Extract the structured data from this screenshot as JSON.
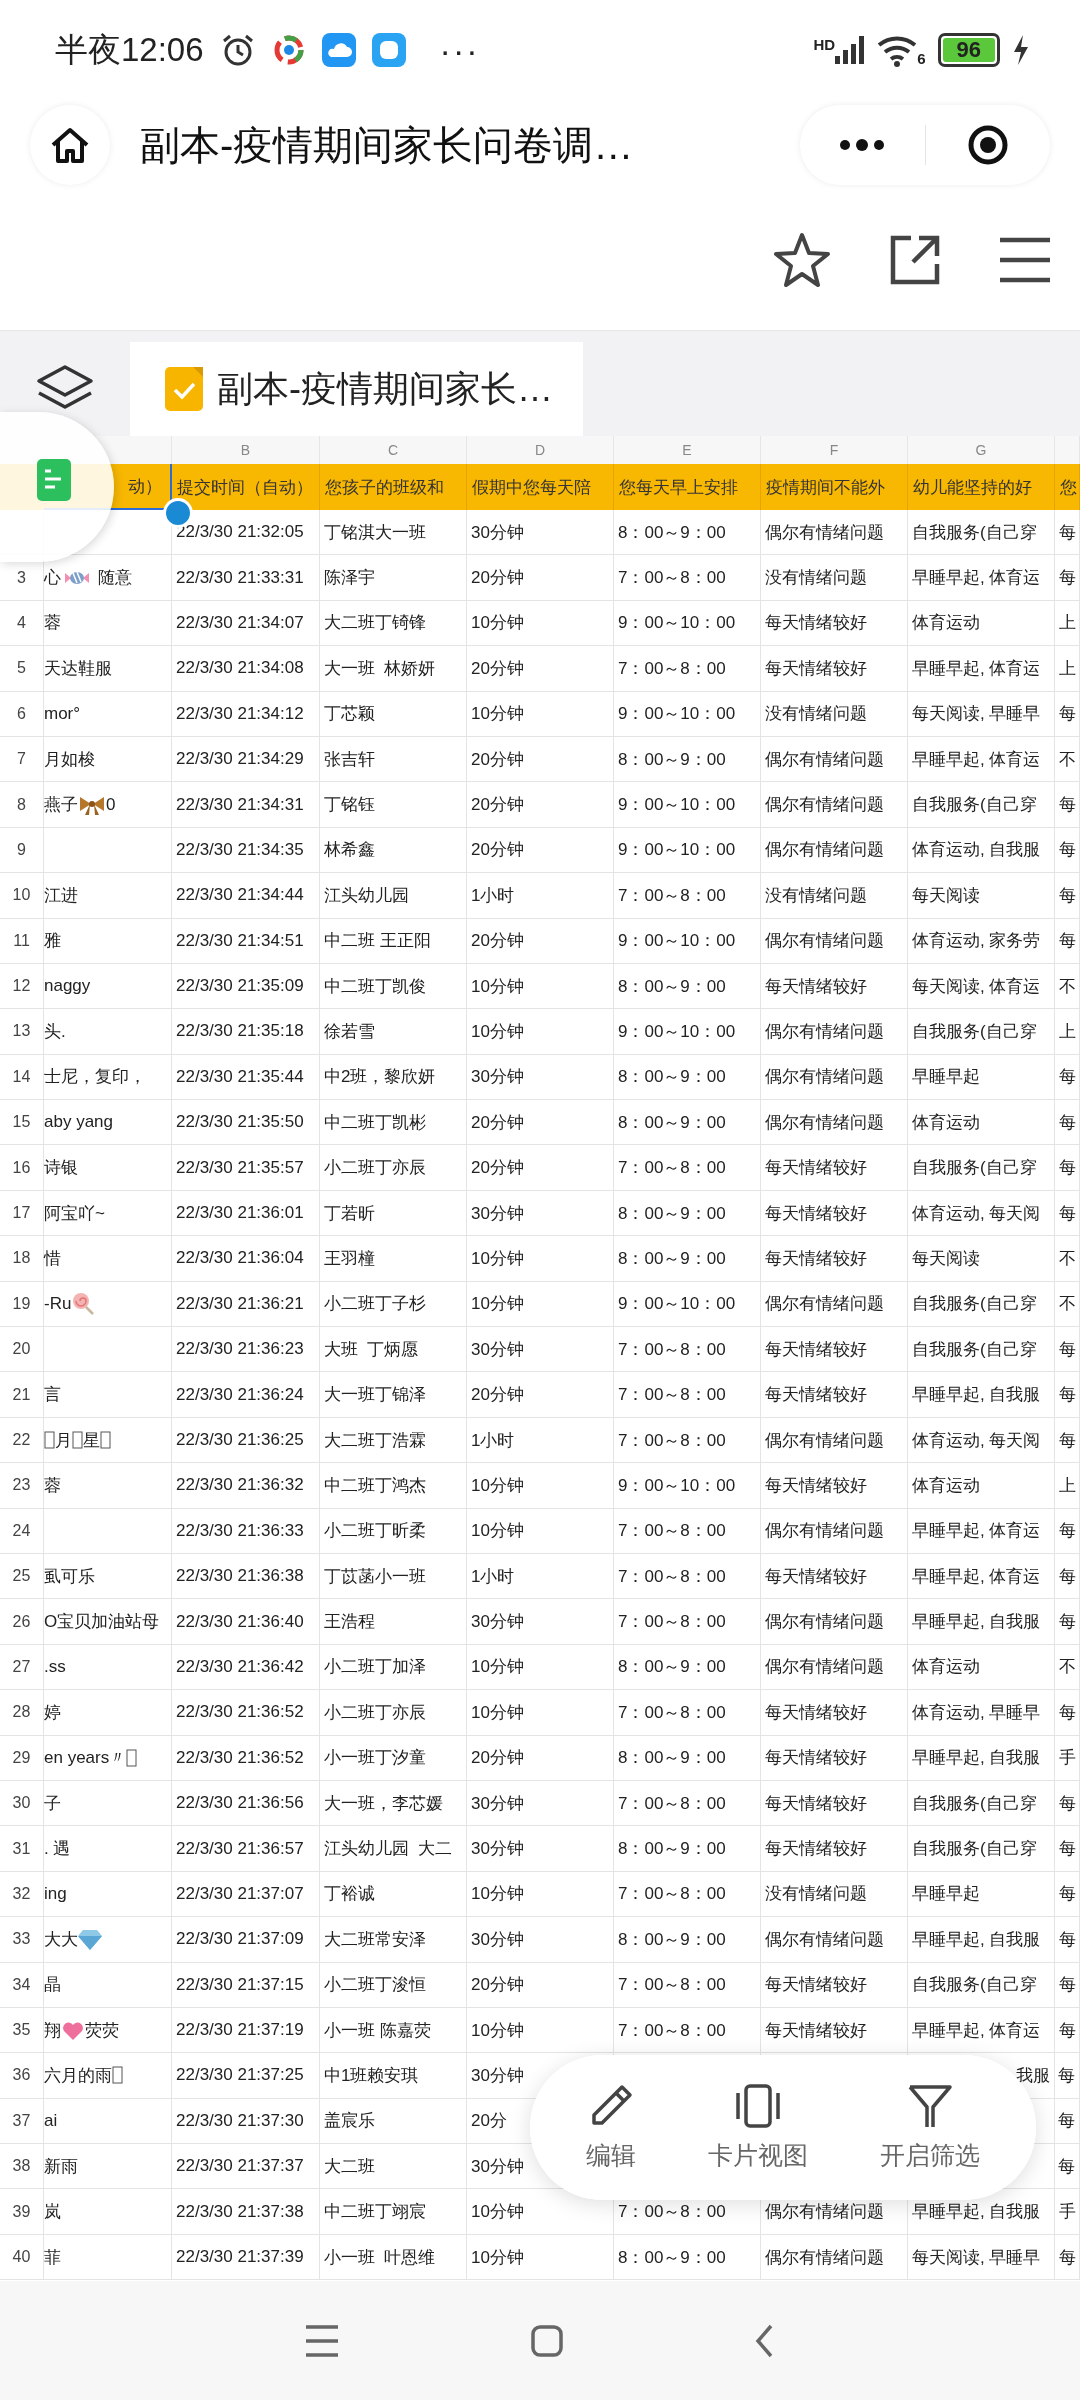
{
  "status_bar": {
    "time": "半夜12:06",
    "more": "···",
    "network_label": "HD",
    "wifi_label": "6",
    "battery": "96"
  },
  "title_bar": {
    "title": "副本-疫情期间家长问卷调…"
  },
  "sheet_tab": {
    "title": "副本-疫情期间家长…"
  },
  "table": {
    "column_letters": [
      "B",
      "C",
      "D",
      "E",
      "F",
      "G"
    ],
    "header": [
      {
        "text": "动）",
        "selected": true
      },
      {
        "text": "提交时间（自动）",
        "selected": false
      },
      {
        "text": "您孩子的班级和",
        "selected": false
      },
      {
        "text": "假期中您每天陪",
        "selected": false
      },
      {
        "text": "您每天早上安排",
        "selected": false
      },
      {
        "text": "疫情期间不能外",
        "selected": false
      },
      {
        "text": "幼儿能坚持的好",
        "selected": false
      },
      {
        "text": "您",
        "selected": false
      }
    ],
    "rows": [
      {
        "b": "22/3/30 21:32:05",
        "c": "丁铭淇大一班",
        "d": "30分钟",
        "e": "8：00～9：00",
        "f": "偶尔有情绪问题",
        "g": "自我服务(自己穿",
        "h": "每"
      },
      {
        "n": "3",
        "a": [
          "心",
          {
            "kind": "candy"
          },
          " 随意"
        ],
        "b": "22/3/30 21:33:31",
        "c": "陈泽宇",
        "d": "20分钟",
        "e": "7：00～8：00",
        "f": "没有情绪问题",
        "g": "早睡早起, 体育运",
        "h": "每"
      },
      {
        "n": "4",
        "a": [
          "蓉"
        ],
        "b": "22/3/30 21:34:07",
        "c": "大二班丁锜锋",
        "d": "10分钟",
        "e": "9：00～10：00",
        "f": "每天情绪较好",
        "g": "体育运动",
        "h": "上"
      },
      {
        "n": "5",
        "a": [
          "天达鞋服"
        ],
        "b": "22/3/30 21:34:08",
        "c": "大一班  林娇妍",
        "d": "20分钟",
        "e": "7：00～8：00",
        "f": "每天情绪较好",
        "g": "早睡早起, 体育运",
        "h": "上"
      },
      {
        "n": "6",
        "a": [
          "mor°"
        ],
        "b": "22/3/30 21:34:12",
        "c": "丁芯颖",
        "d": "10分钟",
        "e": "9：00～10：00",
        "f": "没有情绪问题",
        "g": "每天阅读, 早睡早",
        "h": "每"
      },
      {
        "n": "7",
        "a": [
          "月如梭"
        ],
        "b": "22/3/30 21:34:29",
        "c": "张吉轩",
        "d": "20分钟",
        "e": "8：00～9：00",
        "f": "偶尔有情绪问题",
        "g": "早睡早起, 体育运",
        "h": "不"
      },
      {
        "n": "8",
        "a": [
          "燕子",
          {
            "kind": "bow"
          },
          "0"
        ],
        "b": "22/3/30 21:34:31",
        "c": "丁铭钰",
        "d": "20分钟",
        "e": "9：00～10：00",
        "f": "偶尔有情绪问题",
        "g": "自我服务(自己穿",
        "h": "每"
      },
      {
        "n": "9",
        "b": "22/3/30 21:34:35",
        "c": "林希鑫",
        "d": "20分钟",
        "e": "9：00～10：00",
        "f": "偶尔有情绪问题",
        "g": "体育运动, 自我服",
        "h": "每"
      },
      {
        "n": "10",
        "a": [
          "江进"
        ],
        "b": "22/3/30 21:34:44",
        "c": "江头幼儿园",
        "d": "1小时",
        "e": "7：00～8：00",
        "f": "没有情绪问题",
        "g": "每天阅读",
        "h": "每"
      },
      {
        "n": "11",
        "a": [
          "雅"
        ],
        "b": "22/3/30 21:34:51",
        "c": "中二班 王正阳",
        "d": "20分钟",
        "e": "9：00～10：00",
        "f": "偶尔有情绪问题",
        "g": "体育运动, 家务劳",
        "h": "每"
      },
      {
        "n": "12",
        "a": [
          "naggy"
        ],
        "b": "22/3/30 21:35:09",
        "c": "中二班丁凯俊",
        "d": "10分钟",
        "e": "8：00～9：00",
        "f": "每天情绪较好",
        "g": "每天阅读, 体育运",
        "h": "不"
      },
      {
        "n": "13",
        "a": [
          "头."
        ],
        "b": "22/3/30 21:35:18",
        "c": "徐若雪",
        "d": "10分钟",
        "e": "9：00～10：00",
        "f": "偶尔有情绪问题",
        "g": "自我服务(自己穿",
        "h": "上"
      },
      {
        "n": "14",
        "a": [
          "士尼，复印，"
        ],
        "b": "22/3/30 21:35:44",
        "c": "中2班，黎欣妍",
        "d": "30分钟",
        "e": "8：00～9：00",
        "f": "偶尔有情绪问题",
        "g": "早睡早起",
        "h": "每"
      },
      {
        "n": "15",
        "a": [
          "aby yang"
        ],
        "b": "22/3/30 21:35:50",
        "c": "中二班丁凯彬",
        "d": "20分钟",
        "e": "8：00～9：00",
        "f": "偶尔有情绪问题",
        "g": "体育运动",
        "h": "每"
      },
      {
        "n": "16",
        "a": [
          "诗银"
        ],
        "b": "22/3/30 21:35:57",
        "c": "小二班丁亦辰",
        "d": "20分钟",
        "e": "7：00～8：00",
        "f": "每天情绪较好",
        "g": "自我服务(自己穿",
        "h": "每"
      },
      {
        "n": "17",
        "a": [
          "阿宝吖~"
        ],
        "b": "22/3/30 21:36:01",
        "c": "丁若昕",
        "d": "30分钟",
        "e": "8：00～9：00",
        "f": "每天情绪较好",
        "g": "体育运动, 每天阅",
        "h": "每"
      },
      {
        "n": "18",
        "a": [
          "惜"
        ],
        "b": "22/3/30 21:36:04",
        "c": "王羽橦",
        "d": "10分钟",
        "e": "8：00～9：00",
        "f": "每天情绪较好",
        "g": "每天阅读",
        "h": "不"
      },
      {
        "n": "19",
        "a": [
          "-Ru",
          {
            "kind": "lollipop"
          }
        ],
        "b": "22/3/30 21:36:21",
        "c": "小二班丁子杉",
        "d": "10分钟",
        "e": "9：00～10：00",
        "f": "偶尔有情绪问题",
        "g": "自我服务(自己穿",
        "h": "不"
      },
      {
        "n": "20",
        "b": "22/3/30 21:36:23",
        "c": "大班  丁炳愿",
        "d": "30分钟",
        "e": "7：00～8：00",
        "f": "每天情绪较好",
        "g": "自我服务(自己穿",
        "h": "每"
      },
      {
        "n": "21",
        "a": [
          "言"
        ],
        "b": "22/3/30 21:36:24",
        "c": "大一班丁锦泽",
        "d": "20分钟",
        "e": "7：00～8：00",
        "f": "每天情绪较好",
        "g": "早睡早起, 自我服",
        "h": "每"
      },
      {
        "n": "22",
        "a": [
          {
            "kind": "tofu"
          },
          "月",
          {
            "kind": "tofu"
          },
          "星",
          {
            "kind": "tofu"
          }
        ],
        "b": "22/3/30 21:36:25",
        "c": "大二班丁浩霖",
        "d": "1小时",
        "e": "7：00～8：00",
        "f": "偶尔有情绪问题",
        "g": "体育运动, 每天阅",
        "h": "每"
      },
      {
        "n": "23",
        "a": [
          "蓉"
        ],
        "b": "22/3/30 21:36:32",
        "c": "中二班丁鸿杰",
        "d": "10分钟",
        "e": "9：00～10：00",
        "f": "每天情绪较好",
        "g": "体育运动",
        "h": "上"
      },
      {
        "n": "24",
        "b": "22/3/30 21:36:33",
        "c": "小二班丁昕柔",
        "d": "10分钟",
        "e": "7：00～8：00",
        "f": "偶尔有情绪问题",
        "g": "早睡早起, 体育运",
        "h": "每"
      },
      {
        "n": "25",
        "a": [
          "虱可乐"
        ],
        "b": "22/3/30 21:36:38",
        "c": "丁苡菡小一班",
        "d": "1小时",
        "e": "7：00～8：00",
        "f": "每天情绪较好",
        "g": "早睡早起, 体育运",
        "h": "每"
      },
      {
        "n": "26",
        "a": [
          "O宝贝加油站母"
        ],
        "b": "22/3/30 21:36:40",
        "c": "王浩程",
        "d": "30分钟",
        "e": "7：00～8：00",
        "f": "偶尔有情绪问题",
        "g": "早睡早起, 自我服",
        "h": "每"
      },
      {
        "n": "27",
        "a": [
          ".ss"
        ],
        "b": "22/3/30 21:36:42",
        "c": "小二班丁加泽",
        "d": "10分钟",
        "e": "8：00～9：00",
        "f": "偶尔有情绪问题",
        "g": "体育运动",
        "h": "不"
      },
      {
        "n": "28",
        "a": [
          "婷"
        ],
        "b": "22/3/30 21:36:52",
        "c": "小二班丁亦辰",
        "d": "10分钟",
        "e": "7：00～8：00",
        "f": "每天情绪较好",
        "g": "体育运动, 早睡早",
        "h": "每"
      },
      {
        "n": "29",
        "a": [
          "en years〃",
          {
            "kind": "tofu"
          }
        ],
        "b": "22/3/30 21:36:52",
        "c": "小一班丁汐童",
        "d": "20分钟",
        "e": "8：00～9：00",
        "f": "每天情绪较好",
        "g": "早睡早起, 自我服",
        "h": "手"
      },
      {
        "n": "30",
        "a": [
          "子"
        ],
        "b": "22/3/30 21:36:56",
        "c": "大一班，李芯媛",
        "d": "30分钟",
        "e": "7：00～8：00",
        "f": "每天情绪较好",
        "g": "自我服务(自己穿",
        "h": "每"
      },
      {
        "n": "31",
        "a": [
          ". 遇"
        ],
        "b": "22/3/30 21:36:57",
        "c": "江头幼儿园  大二",
        "d": "30分钟",
        "e": "8：00～9：00",
        "f": "每天情绪较好",
        "g": "自我服务(自己穿",
        "h": "每"
      },
      {
        "n": "32",
        "a": [
          "ing"
        ],
        "b": "22/3/30 21:37:07",
        "c": "丁裕诚",
        "d": "10分钟",
        "e": "7：00～8：00",
        "f": "没有情绪问题",
        "g": "早睡早起",
        "h": "每"
      },
      {
        "n": "33",
        "a": [
          "大大",
          {
            "kind": "gem"
          }
        ],
        "b": "22/3/30 21:37:09",
        "c": "大二班常安泽",
        "d": "30分钟",
        "e": "8：00～9：00",
        "f": "偶尔有情绪问题",
        "g": "早睡早起, 自我服",
        "h": "每"
      },
      {
        "n": "34",
        "a": [
          "晶"
        ],
        "b": "22/3/30 21:37:15",
        "c": "小二班丁浚恒",
        "d": "20分钟",
        "e": "7：00～8：00",
        "f": "每天情绪较好",
        "g": "自我服务(自己穿",
        "h": "每"
      },
      {
        "n": "35",
        "a": [
          "翔",
          {
            "kind": "heart"
          },
          "荧荧"
        ],
        "b": "22/3/30 21:37:19",
        "c": "小一班 陈嘉荧",
        "d": "10分钟",
        "e": "7：00～8：00",
        "f": "每天情绪较好",
        "g": "早睡早起, 体育运",
        "h": "每"
      },
      {
        "n": "36",
        "a": [
          "六月的雨",
          {
            "kind": "tofu"
          }
        ],
        "b": "22/3/30 21:37:25",
        "c": "中1班赖安琪",
        "d": "30分钟",
        "g": "我服",
        "h": "每"
      },
      {
        "n": "37",
        "a": [
          "ai"
        ],
        "b": "22/3/30 21:37:30",
        "c": "盖宸乐",
        "d": "20分",
        "h": "每"
      },
      {
        "n": "38",
        "a": [
          "新雨"
        ],
        "b": "22/3/30 21:37:37",
        "c": "大二班",
        "d": "30分钟",
        "h": "每"
      },
      {
        "n": "39",
        "a": [
          "岚"
        ],
        "b": "22/3/30 21:37:38",
        "c": "中二班丁翊宸",
        "d": "10分钟",
        "e": "7：00～8：00",
        "f": "偶尔有情绪问题",
        "g": "早睡早起, 自我服",
        "h": "手"
      },
      {
        "n": "40",
        "a": [
          "菲"
        ],
        "b": "22/3/30 21:37:39",
        "c": "小一班  叶恩维",
        "d": "10分钟",
        "e": "8：00～9：00",
        "f": "偶尔有情绪问题",
        "g": "每天阅读, 早睡早",
        "h": "每"
      }
    ]
  },
  "actions": [
    {
      "label": "编辑",
      "kind": "edit"
    },
    {
      "label": "卡片视图",
      "kind": "cards"
    },
    {
      "label": "开启筛选",
      "kind": "filter"
    }
  ]
}
